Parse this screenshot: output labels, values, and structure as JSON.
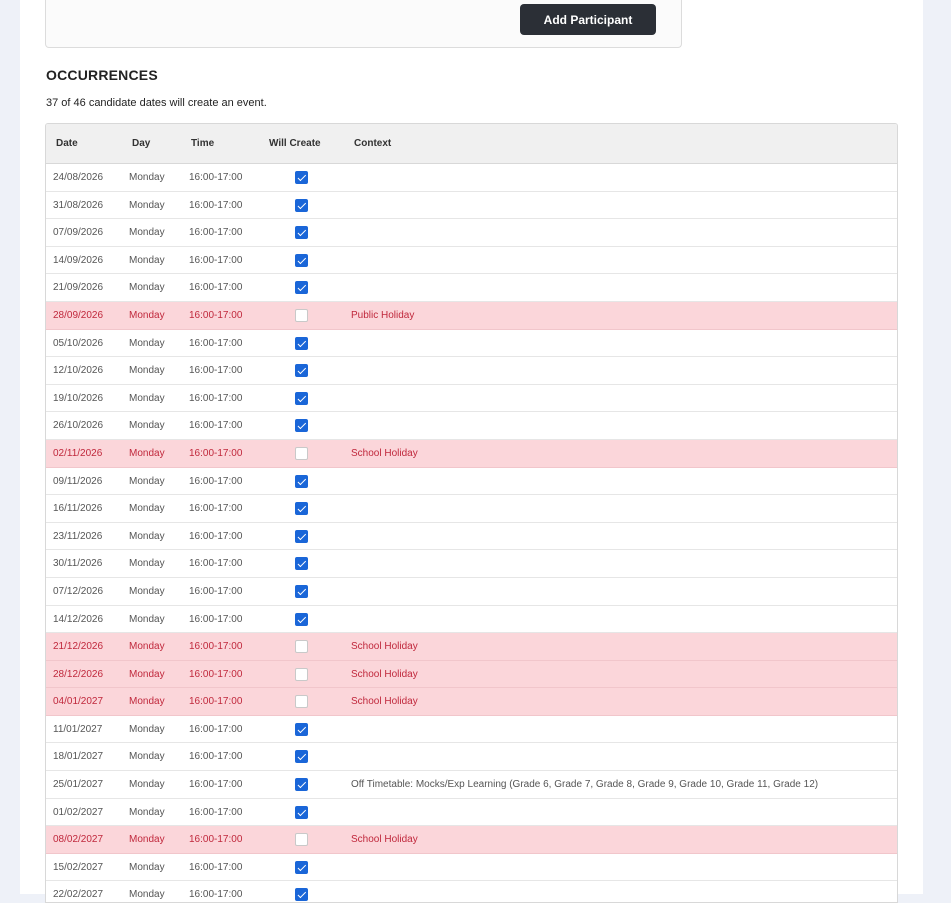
{
  "participant": {
    "add_button_label": "Add Participant"
  },
  "occurrences": {
    "title": "OCCURRENCES",
    "summary": "37 of 46 candidate dates will create an event.",
    "columns": [
      "Date",
      "Day",
      "Time",
      "Will Create",
      "Context"
    ],
    "rows": [
      {
        "date": "24/08/2026",
        "day": "Monday",
        "time": "16:00-17:00",
        "will_create": true,
        "context": ""
      },
      {
        "date": "31/08/2026",
        "day": "Monday",
        "time": "16:00-17:00",
        "will_create": true,
        "context": ""
      },
      {
        "date": "07/09/2026",
        "day": "Monday",
        "time": "16:00-17:00",
        "will_create": true,
        "context": ""
      },
      {
        "date": "14/09/2026",
        "day": "Monday",
        "time": "16:00-17:00",
        "will_create": true,
        "context": ""
      },
      {
        "date": "21/09/2026",
        "day": "Monday",
        "time": "16:00-17:00",
        "will_create": true,
        "context": ""
      },
      {
        "date": "28/09/2026",
        "day": "Monday",
        "time": "16:00-17:00",
        "will_create": false,
        "context": "Public Holiday"
      },
      {
        "date": "05/10/2026",
        "day": "Monday",
        "time": "16:00-17:00",
        "will_create": true,
        "context": ""
      },
      {
        "date": "12/10/2026",
        "day": "Monday",
        "time": "16:00-17:00",
        "will_create": true,
        "context": ""
      },
      {
        "date": "19/10/2026",
        "day": "Monday",
        "time": "16:00-17:00",
        "will_create": true,
        "context": ""
      },
      {
        "date": "26/10/2026",
        "day": "Monday",
        "time": "16:00-17:00",
        "will_create": true,
        "context": ""
      },
      {
        "date": "02/11/2026",
        "day": "Monday",
        "time": "16:00-17:00",
        "will_create": false,
        "context": "School Holiday"
      },
      {
        "date": "09/11/2026",
        "day": "Monday",
        "time": "16:00-17:00",
        "will_create": true,
        "context": ""
      },
      {
        "date": "16/11/2026",
        "day": "Monday",
        "time": "16:00-17:00",
        "will_create": true,
        "context": ""
      },
      {
        "date": "23/11/2026",
        "day": "Monday",
        "time": "16:00-17:00",
        "will_create": true,
        "context": ""
      },
      {
        "date": "30/11/2026",
        "day": "Monday",
        "time": "16:00-17:00",
        "will_create": true,
        "context": ""
      },
      {
        "date": "07/12/2026",
        "day": "Monday",
        "time": "16:00-17:00",
        "will_create": true,
        "context": ""
      },
      {
        "date": "14/12/2026",
        "day": "Monday",
        "time": "16:00-17:00",
        "will_create": true,
        "context": ""
      },
      {
        "date": "21/12/2026",
        "day": "Monday",
        "time": "16:00-17:00",
        "will_create": false,
        "context": "School Holiday"
      },
      {
        "date": "28/12/2026",
        "day": "Monday",
        "time": "16:00-17:00",
        "will_create": false,
        "context": "School Holiday"
      },
      {
        "date": "04/01/2027",
        "day": "Monday",
        "time": "16:00-17:00",
        "will_create": false,
        "context": "School Holiday"
      },
      {
        "date": "11/01/2027",
        "day": "Monday",
        "time": "16:00-17:00",
        "will_create": true,
        "context": ""
      },
      {
        "date": "18/01/2027",
        "day": "Monday",
        "time": "16:00-17:00",
        "will_create": true,
        "context": ""
      },
      {
        "date": "25/01/2027",
        "day": "Monday",
        "time": "16:00-17:00",
        "will_create": true,
        "context": "Off Timetable: Mocks/Exp Learning (Grade 6, Grade 7, Grade 8, Grade 9, Grade 10, Grade 11, Grade 12)"
      },
      {
        "date": "01/02/2027",
        "day": "Monday",
        "time": "16:00-17:00",
        "will_create": true,
        "context": ""
      },
      {
        "date": "08/02/2027",
        "day": "Monday",
        "time": "16:00-17:00",
        "will_create": false,
        "context": "School Holiday"
      },
      {
        "date": "15/02/2027",
        "day": "Monday",
        "time": "16:00-17:00",
        "will_create": true,
        "context": ""
      },
      {
        "date": "22/02/2027",
        "day": "Monday",
        "time": "16:00-17:00",
        "will_create": true,
        "context": ""
      }
    ]
  }
}
